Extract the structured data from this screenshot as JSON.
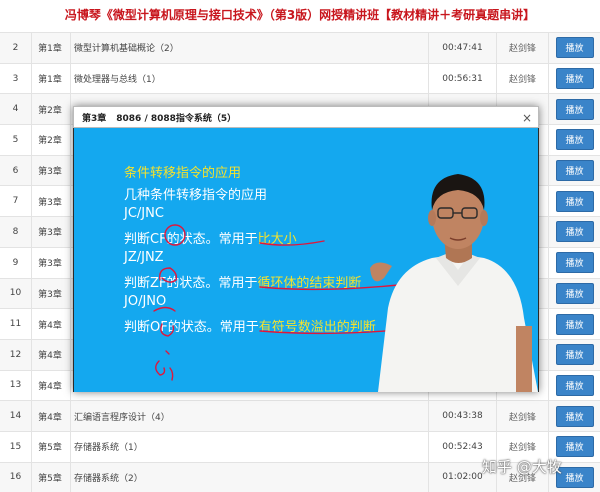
{
  "page_title": "冯博琴《微型计算机原理与接口技术》（第3版）网授精讲班【教材精讲＋考研真题串讲】",
  "play_label": "播放",
  "lessons": [
    {
      "num": "2",
      "chapter": "第1章",
      "title": "微型计算机基础概论（2）",
      "duration": "00:47:41",
      "teacher": "赵剑锋"
    },
    {
      "num": "3",
      "chapter": "第1章",
      "title": "微处理器与总线（1）",
      "duration": "00:56:31",
      "teacher": "赵剑锋"
    },
    {
      "num": "4",
      "chapter": "第2章",
      "title": "",
      "duration": "",
      "teacher": ""
    },
    {
      "num": "5",
      "chapter": "第2章",
      "title": "",
      "duration": "",
      "teacher": ""
    },
    {
      "num": "6",
      "chapter": "第3章",
      "title": "",
      "duration": "",
      "teacher": ""
    },
    {
      "num": "7",
      "chapter": "第3章",
      "title": "",
      "duration": "",
      "teacher": ""
    },
    {
      "num": "8",
      "chapter": "第3章",
      "title": "",
      "duration": "",
      "teacher": ""
    },
    {
      "num": "9",
      "chapter": "第3章",
      "title": "",
      "duration": "",
      "teacher": ""
    },
    {
      "num": "10",
      "chapter": "第3章",
      "title": "",
      "duration": "",
      "teacher": ""
    },
    {
      "num": "11",
      "chapter": "第4章",
      "title": "",
      "duration": "",
      "teacher": ""
    },
    {
      "num": "12",
      "chapter": "第4章",
      "title": "",
      "duration": "",
      "teacher": ""
    },
    {
      "num": "13",
      "chapter": "第4章",
      "title": "",
      "duration": "",
      "teacher": ""
    },
    {
      "num": "14",
      "chapter": "第4章",
      "title": "汇编语言程序设计（4）",
      "duration": "00:43:38",
      "teacher": "赵剑锋"
    },
    {
      "num": "15",
      "chapter": "第5章",
      "title": "存储器系统（1）",
      "duration": "00:52:43",
      "teacher": "赵剑锋"
    },
    {
      "num": "16",
      "chapter": "第5章",
      "title": "存储器系统（2）",
      "duration": "01:02:00",
      "teacher": "赵剑锋"
    }
  ],
  "video_popup": {
    "chapter": "第3章",
    "title": "8086 / 8088指令系统（5）",
    "close_glyph": "×"
  },
  "slide": {
    "line1": "条件转移指令的应用",
    "line2": "几种条件转移指令的应用",
    "line3": "JC/JNC",
    "line4_a": "判断",
    "line4_flag": "CF",
    "line4_b": "的状态。常用于",
    "line4_c": "比大小",
    "line5": "JZ/JNZ",
    "line6_a": "判断",
    "line6_flag": "ZF",
    "line6_b": "的状态。常用于",
    "line6_c": "循环体的结束判断",
    "line7": "JO/JNO",
    "line8_a": "判断",
    "line8_flag": "OF",
    "line8_b": "的状态。常用于",
    "line8_c": "有符号数溢出的判断"
  },
  "watermark": "知乎 @大牧",
  "colors": {
    "title_red": "#c8161d",
    "slide_blue": "#14a8ef",
    "slide_yellow": "#f5e22c",
    "button_blue": "#3a84c9",
    "annotation_red": "#e0163c"
  }
}
